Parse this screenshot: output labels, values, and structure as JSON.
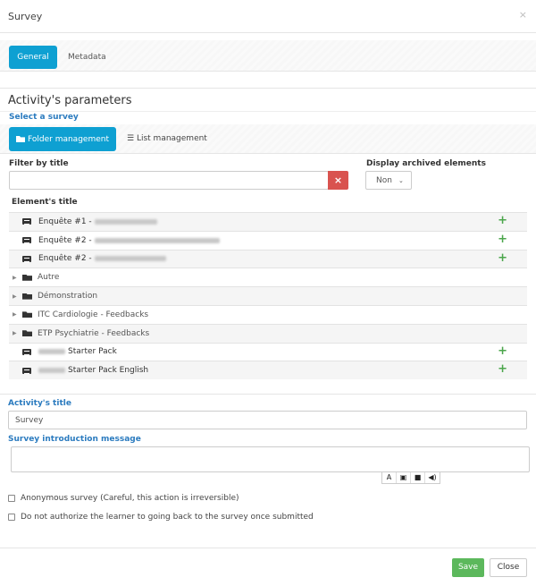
{
  "modal": {
    "title": "Survey",
    "close_icon": "×"
  },
  "tabs": [
    {
      "label": "General",
      "active": true
    },
    {
      "label": "Metadata",
      "active": false
    }
  ],
  "section_title": "Activity's parameters",
  "select_survey_label": "Select a survey",
  "view_buttons": {
    "folder": "Folder management",
    "list": "List management"
  },
  "filter": {
    "label": "Filter by title",
    "value": "",
    "clear_icon": "×"
  },
  "archived": {
    "label": "Display archived elements",
    "value": "Non"
  },
  "table": {
    "header": "Element's title",
    "rows": [
      {
        "type": "survey",
        "label": "Enquête #1 -",
        "blurred": true
      },
      {
        "type": "survey",
        "label": "Enquête #2 -",
        "blurred": true
      },
      {
        "type": "survey",
        "label": "Enquête #2 -",
        "blurred": true
      },
      {
        "type": "folder",
        "label": "Autre"
      },
      {
        "type": "folder",
        "label": "Démonstration"
      },
      {
        "type": "folder",
        "label": "ITC Cardiologie - Feedbacks"
      },
      {
        "type": "folder",
        "label": "ETP Psychiatrie - Feedbacks"
      },
      {
        "type": "survey",
        "label": "Starter Pack",
        "blurred_prefix": true
      },
      {
        "type": "survey",
        "label": "Starter Pack English",
        "blurred_prefix": true
      }
    ]
  },
  "activity_title": {
    "label": "Activity's title",
    "value": "Survey"
  },
  "intro": {
    "label": "Survey introduction message",
    "value": "",
    "toolbar": [
      "A",
      "image-icon",
      "video-icon",
      "audio-icon"
    ]
  },
  "options": [
    {
      "label": "Anonymous survey (Careful, this action is irreversible)",
      "checked": false
    },
    {
      "label": "Do not authorize the learner to going back to the survey once submitted",
      "checked": false
    }
  ],
  "footer": {
    "save": "Save",
    "close": "Close"
  },
  "colors": {
    "primary": "#0ea0d2",
    "danger": "#d9534f",
    "success": "#5cb85c",
    "label_blue": "#2b7bbf"
  }
}
